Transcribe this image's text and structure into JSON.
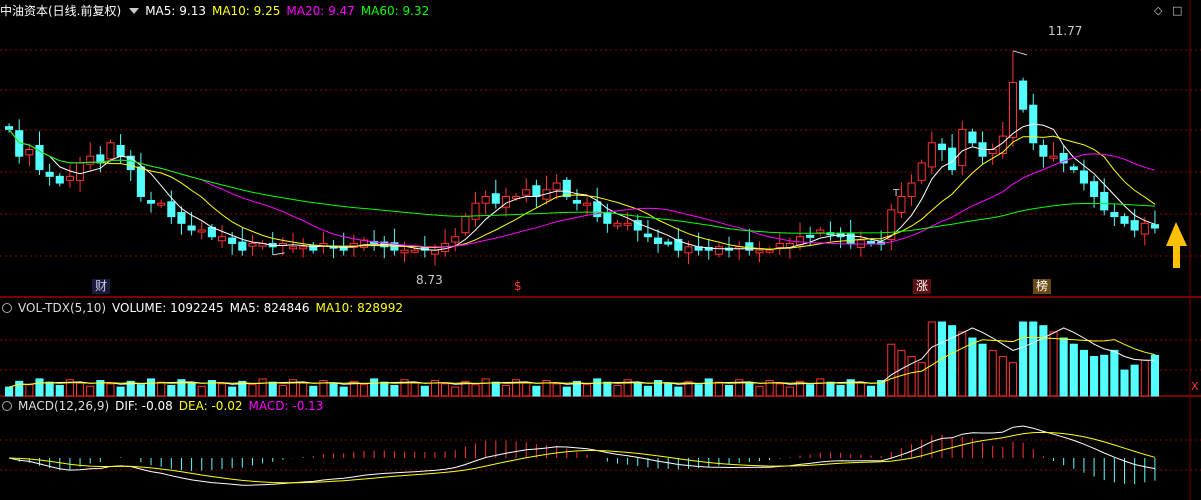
{
  "main": {
    "title": "中油资本(日线.前复权)",
    "ma5": "MA5: 9.13",
    "ma10": "MA10: 9.25",
    "ma20": "MA20: 9.47",
    "ma60": "MA60: 9.32",
    "high_label": "11.77",
    "low_label": "8.73",
    "markers": [
      "财",
      "$",
      "涨",
      "榜"
    ],
    "t_label": "T"
  },
  "vol": {
    "title": "VOL-TDX(5,10)",
    "volume": "VOLUME: 1092245",
    "ma5": "MA5: 824846",
    "ma10": "MA10: 828992",
    "x_mark": "X"
  },
  "macd": {
    "title": "MACD(12,26,9)",
    "dif": "DIF: -0.08",
    "dea": "DEA: -0.02",
    "macd": "MACD: -0.13"
  },
  "colors": {
    "up": "#ff3232",
    "down": "#54ffff",
    "ma5": "#ffffff",
    "ma10": "#ffff00",
    "ma20": "#ff00ff",
    "ma60": "#00ff00",
    "arrow": "#ffc000",
    "grid": "#8b0000"
  },
  "chart_data": {
    "type": "candlestick",
    "title": "中油资本(日线.前复权)",
    "price_range": [
      8.4,
      12.2
    ],
    "high": 11.77,
    "low": 8.73,
    "close_series": [
      10.6,
      10.2,
      10.3,
      10.0,
      9.9,
      9.8,
      9.9,
      10.1,
      10.2,
      10.1,
      10.4,
      10.2,
      10.0,
      9.6,
      9.5,
      9.5,
      9.3,
      9.2,
      9.1,
      9.1,
      9.0,
      9.0,
      8.9,
      8.8,
      8.9,
      8.9,
      8.85,
      8.9,
      8.85,
      8.85,
      8.8,
      8.9,
      8.85,
      8.8,
      8.9,
      8.95,
      8.9,
      8.85,
      8.8,
      8.8,
      8.8,
      8.8,
      8.8,
      8.9,
      9.0,
      9.3,
      9.5,
      9.6,
      9.5,
      9.6,
      9.6,
      9.7,
      9.6,
      9.7,
      9.8,
      9.6,
      9.5,
      9.5,
      9.3,
      9.2,
      9.2,
      9.2,
      9.1,
      9.0,
      8.9,
      8.9,
      8.8,
      8.85,
      8.8,
      8.8,
      8.85,
      8.8,
      8.85,
      8.8,
      8.8,
      8.8,
      8.9,
      8.9,
      9.0,
      9.0,
      9.1,
      9.05,
      9.0,
      8.9,
      8.95,
      8.9,
      8.9,
      9.4,
      9.6,
      9.8,
      10.1,
      10.4,
      10.3,
      10.0,
      10.6,
      10.4,
      10.2,
      10.3,
      10.5,
      11.3,
      10.9,
      10.4,
      10.2,
      10.2,
      10.1,
      10.0,
      9.8,
      9.6,
      9.4,
      9.3,
      9.2,
      9.1,
      9.2,
      9.13
    ],
    "volume_latest": 1092245,
    "macd_latest": {
      "dif": -0.08,
      "dea": -0.02,
      "macd": -0.13
    }
  }
}
